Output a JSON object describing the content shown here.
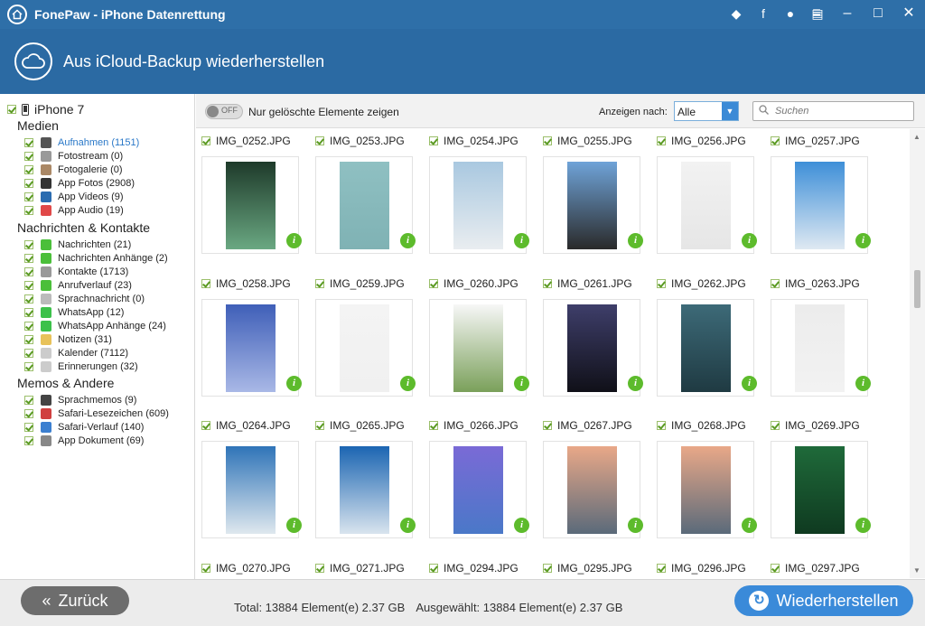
{
  "window": {
    "title": "FonePaw - iPhone Datenrettung"
  },
  "header": {
    "title": "Aus iCloud-Backup wiederherstellen"
  },
  "sidebar": {
    "device": "iPhone 7",
    "sections": [
      {
        "title": "Medien",
        "items": [
          {
            "label": "Aufnahmen (1151)",
            "icon": "camera-icon",
            "color": "#555",
            "active": true
          },
          {
            "label": "Fotostream (0)",
            "icon": "photostream-icon",
            "color": "#999"
          },
          {
            "label": "Fotogalerie (0)",
            "icon": "gallery-icon",
            "color": "#aa8866"
          },
          {
            "label": "App Fotos (2908)",
            "icon": "app-photos-icon",
            "color": "#333"
          },
          {
            "label": "App Videos (9)",
            "icon": "app-videos-icon",
            "color": "#2b6cb0"
          },
          {
            "label": "App Audio (19)",
            "icon": "app-audio-icon",
            "color": "#e04848"
          }
        ]
      },
      {
        "title": "Nachrichten & Kontakte",
        "items": [
          {
            "label": "Nachrichten (21)",
            "icon": "messages-icon",
            "color": "#4bbf3a"
          },
          {
            "label": "Nachrichten Anhänge (2)",
            "icon": "attachments-icon",
            "color": "#4bbf3a"
          },
          {
            "label": "Kontakte (1713)",
            "icon": "contacts-icon",
            "color": "#999"
          },
          {
            "label": "Anrufverlauf (23)",
            "icon": "call-log-icon",
            "color": "#4bbf3a"
          },
          {
            "label": "Sprachnachricht (0)",
            "icon": "voicemail-icon",
            "color": "#bbb"
          },
          {
            "label": "WhatsApp (12)",
            "icon": "whatsapp-icon",
            "color": "#3cc14a"
          },
          {
            "label": "WhatsApp Anhänge (24)",
            "icon": "whatsapp-attachments-icon",
            "color": "#3cc14a"
          },
          {
            "label": "Notizen (31)",
            "icon": "notes-icon",
            "color": "#e8c25a"
          },
          {
            "label": "Kalender (7112)",
            "icon": "calendar-icon",
            "color": "#ccc"
          },
          {
            "label": "Erinnerungen (32)",
            "icon": "reminders-icon",
            "color": "#ccc"
          }
        ]
      },
      {
        "title": "Memos & Andere",
        "items": [
          {
            "label": "Sprachmemos (9)",
            "icon": "voice-memos-icon",
            "color": "#444"
          },
          {
            "label": "Safari-Lesezeichen (609)",
            "icon": "safari-bookmarks-icon",
            "color": "#d04040"
          },
          {
            "label": "Safari-Verlauf (140)",
            "icon": "safari-history-icon",
            "color": "#3b7fd0"
          },
          {
            "label": "App Dokument (69)",
            "icon": "app-document-icon",
            "color": "#888"
          }
        ]
      }
    ]
  },
  "toolbar": {
    "toggle_state": "OFF",
    "toggle_label": "Nur gelöschte Elemente zeigen",
    "show_by_label": "Anzeigen nach:",
    "show_by_value": "Alle",
    "search_placeholder": "Suchen"
  },
  "grid": {
    "rows": [
      [
        {
          "name": "IMG_0252.JPG",
          "c1": "#1e3a2a",
          "c2": "#6aa882"
        },
        {
          "name": "IMG_0253.JPG",
          "c1": "#8fc0c2",
          "c2": "#7fb2b4"
        },
        {
          "name": "IMG_0254.JPG",
          "c1": "#a9c8e0",
          "c2": "#e9edf0"
        },
        {
          "name": "IMG_0255.JPG",
          "c1": "#6fa3d8",
          "c2": "#2a2a2a"
        },
        {
          "name": "IMG_0256.JPG",
          "c1": "#f2f2f2",
          "c2": "#e6e6e6"
        },
        {
          "name": "IMG_0257.JPG",
          "c1": "#3e8fd8",
          "c2": "#dfe9f2"
        }
      ],
      [
        {
          "name": "IMG_0258.JPG",
          "c1": "#3f5fb8",
          "c2": "#a9b8e6"
        },
        {
          "name": "IMG_0259.JPG",
          "c1": "#f4f4f4",
          "c2": "#f0f0f0"
        },
        {
          "name": "IMG_0260.JPG",
          "c1": "#f7f7f7",
          "c2": "#7aa05a"
        },
        {
          "name": "IMG_0261.JPG",
          "c1": "#3e3e6a",
          "c2": "#101018"
        },
        {
          "name": "IMG_0262.JPG",
          "c1": "#3d6a78",
          "c2": "#1f3a42"
        },
        {
          "name": "IMG_0263.JPG",
          "c1": "#ececec",
          "c2": "#f2f2f2"
        }
      ],
      [
        {
          "name": "IMG_0264.JPG",
          "c1": "#2f74b8",
          "c2": "#dfe8ee"
        },
        {
          "name": "IMG_0265.JPG",
          "c1": "#1b65b2",
          "c2": "#d9e4ee"
        },
        {
          "name": "IMG_0266.JPG",
          "c1": "#7a6ad6",
          "c2": "#4a78c8"
        },
        {
          "name": "IMG_0267.JPG",
          "c1": "#e9a888",
          "c2": "#5a6a7a"
        },
        {
          "name": "IMG_0268.JPG",
          "c1": "#e9a888",
          "c2": "#5a6a7a"
        },
        {
          "name": "IMG_0269.JPG",
          "c1": "#1f6a3a",
          "c2": "#0f3a20"
        }
      ],
      [
        {
          "name": "IMG_0270.JPG"
        },
        {
          "name": "IMG_0271.JPG"
        },
        {
          "name": "IMG_0294.JPG"
        },
        {
          "name": "IMG_0295.JPG"
        },
        {
          "name": "IMG_0296.JPG"
        },
        {
          "name": "IMG_0297.JPG"
        }
      ]
    ]
  },
  "footer": {
    "back_label": "Zurück",
    "total": "Total: 13884 Element(e) 2.37 GB",
    "selected": "Ausgewählt: 13884 Element(e) 2.37 GB",
    "restore_label": "Wiederherstellen"
  },
  "colors": {
    "accent": "#2b6aa3",
    "restore": "#3a8ad9",
    "info": "#5dbb2c"
  }
}
